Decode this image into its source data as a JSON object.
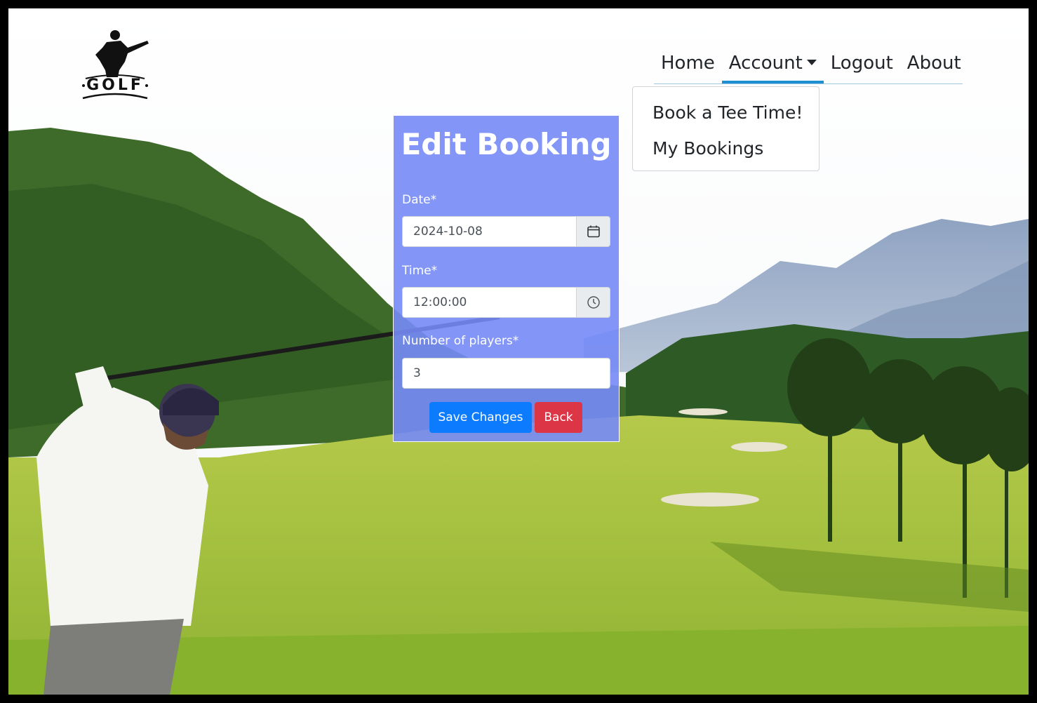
{
  "nav": {
    "home": "Home",
    "account": "Account",
    "logout": "Logout",
    "about": "About"
  },
  "dropdown": {
    "items": [
      "Book a Tee Time!",
      "My Bookings"
    ]
  },
  "logo": {
    "text": "GOLF"
  },
  "form": {
    "title": "Edit Booking",
    "date_label": "Date*",
    "date_value": "2024-10-08",
    "time_label": "Time*",
    "time_value": "12:00:00",
    "players_label": "Number of players*",
    "players_value": "3",
    "save_label": "Save Changes",
    "back_label": "Back"
  },
  "colors": {
    "card": "#768bf7",
    "save_button": "#0d7bfd",
    "back_button": "#dc3545",
    "nav_active": "#1f8fd3"
  }
}
